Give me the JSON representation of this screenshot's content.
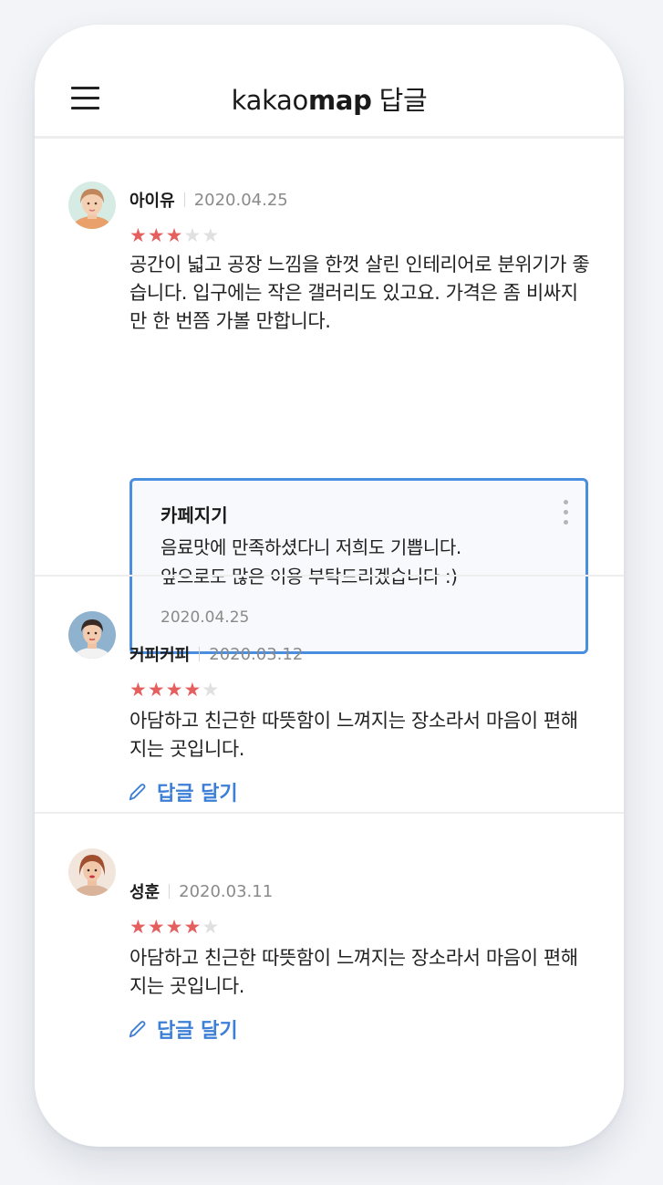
{
  "header": {
    "brand_light": "kakao",
    "brand_bold": "map",
    "title_suffix": "답글"
  },
  "reviews": [
    {
      "author": "아이유",
      "date": "2020.04.25",
      "rating": 3,
      "rating_max": 5,
      "text": "공간이 넓고 공장 느낌을 한껏 살린 인테리어로 분위기가 좋습니다. 입구에는 작은 갤러리도 있고요. 가격은 좀 비싸지만 한 번쯤 가볼 만합니다.",
      "reply": {
        "author": "카페지기",
        "text_line1": "음료맛에 만족하셨다니 저희도 기쁩니다.",
        "text_line2": "앞으로도 많은 이용 부탁드리겠습니다 :)",
        "date": "2020.04.25"
      }
    },
    {
      "author": "커피커피",
      "date": "2020.03.12",
      "rating": 4,
      "rating_max": 5,
      "text": "아담하고 친근한 따뜻함이 느껴지는 장소라서 마음이 편해지는 곳입니다.",
      "reply_button_label": "답글 달기"
    },
    {
      "author": "성훈",
      "date": "2020.03.11",
      "rating": 4,
      "rating_max": 5,
      "text": "아담하고 친근한 따뜻함이 느껴지는 장소라서 마음이 편해지는 곳입니다.",
      "reply_button_label": "답글 달기"
    }
  ],
  "icons": {
    "menu": "menu-icon",
    "more": "more-vertical-icon",
    "reply": "pencil-icon",
    "star": "star-icon"
  },
  "colors": {
    "accent": "#3d7fd6",
    "reply_border": "#4a8ee0",
    "star_on": "#e55f5f",
    "star_off": "#e0e0e0"
  }
}
